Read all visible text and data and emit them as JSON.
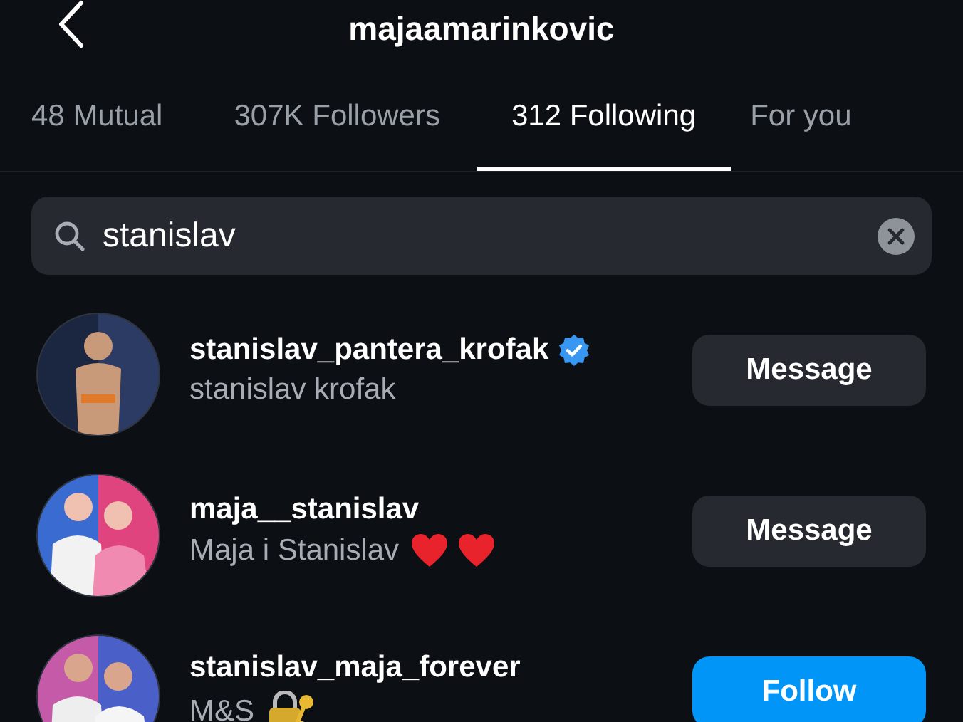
{
  "header": {
    "title": "majaamarinkovic"
  },
  "tabs": [
    {
      "label": "48 Mutual",
      "selected": false
    },
    {
      "label": "307K Followers",
      "selected": false
    },
    {
      "label": "312 Following",
      "selected": true
    },
    {
      "label": "For you",
      "selected": false
    }
  ],
  "search": {
    "value": "stanislav"
  },
  "accounts": [
    {
      "username": "stanislav_pantera_krofak",
      "verified": true,
      "full_name": "stanislav krofak",
      "avatar": {
        "kind": "picture"
      },
      "button": {
        "kind": "message",
        "label": "Message"
      }
    },
    {
      "username": "maja__stanislav",
      "verified": false,
      "full_name": "Maja i Stanislav",
      "emoji": [
        {
          "kind": "heart"
        },
        {
          "kind": "heart"
        }
      ],
      "avatar": {
        "kind": "picture"
      },
      "button": {
        "kind": "message",
        "label": "Message"
      }
    },
    {
      "username": "stanislav_maja_forever",
      "verified": false,
      "full_name": "M&S",
      "emoji": [
        {
          "kind": "lock"
        }
      ],
      "avatar": {
        "kind": "picture"
      },
      "button": {
        "kind": "follow",
        "label": "Follow"
      }
    }
  ]
}
